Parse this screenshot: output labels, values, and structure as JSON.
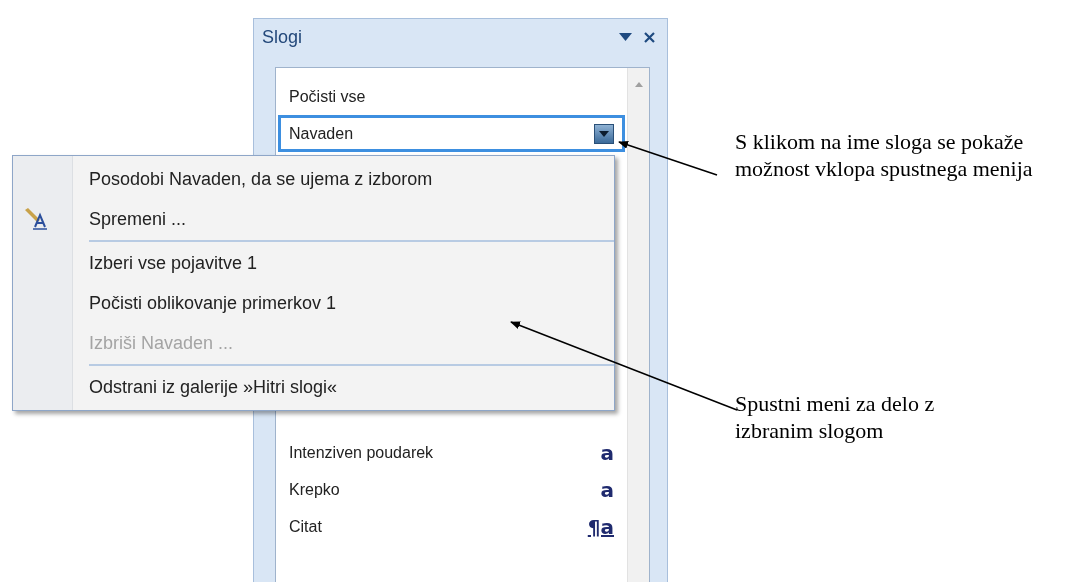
{
  "pane": {
    "title": "Slogi",
    "styles": [
      {
        "label": "Počisti vse",
        "selected": false
      },
      {
        "label": "Navaden",
        "selected": true,
        "has_dropdown": true
      },
      {
        "label": "Intenziven poudarek",
        "selected": false,
        "marker": "a"
      },
      {
        "label": "Krepko",
        "selected": false,
        "marker": "a"
      },
      {
        "label": "Citat",
        "selected": false,
        "marker": "¶a",
        "marker_underlined": true
      }
    ]
  },
  "context_menu": {
    "items": [
      {
        "kind": "item",
        "label": "Posodobi Navaden, da se ujema z izborom",
        "disabled": false
      },
      {
        "kind": "item",
        "label": "Spremeni ...",
        "disabled": false,
        "has_icon": true
      },
      {
        "kind": "separator"
      },
      {
        "kind": "item",
        "label": "Izberi vse pojavitve 1",
        "disabled": false
      },
      {
        "kind": "item",
        "label": "Počisti oblikovanje primerkov 1",
        "disabled": false
      },
      {
        "kind": "item",
        "label": "Izbriši Navaden ...",
        "disabled": true
      },
      {
        "kind": "separator"
      },
      {
        "kind": "item",
        "label": "Odstrani iz galerije »Hitri slogi«",
        "disabled": false
      }
    ]
  },
  "annotations": [
    {
      "text": "S klikom na ime sloga se pokaže možnost vklopa spustnega menija"
    },
    {
      "text": "Spustni meni za delo z izbranim slogom"
    }
  ]
}
